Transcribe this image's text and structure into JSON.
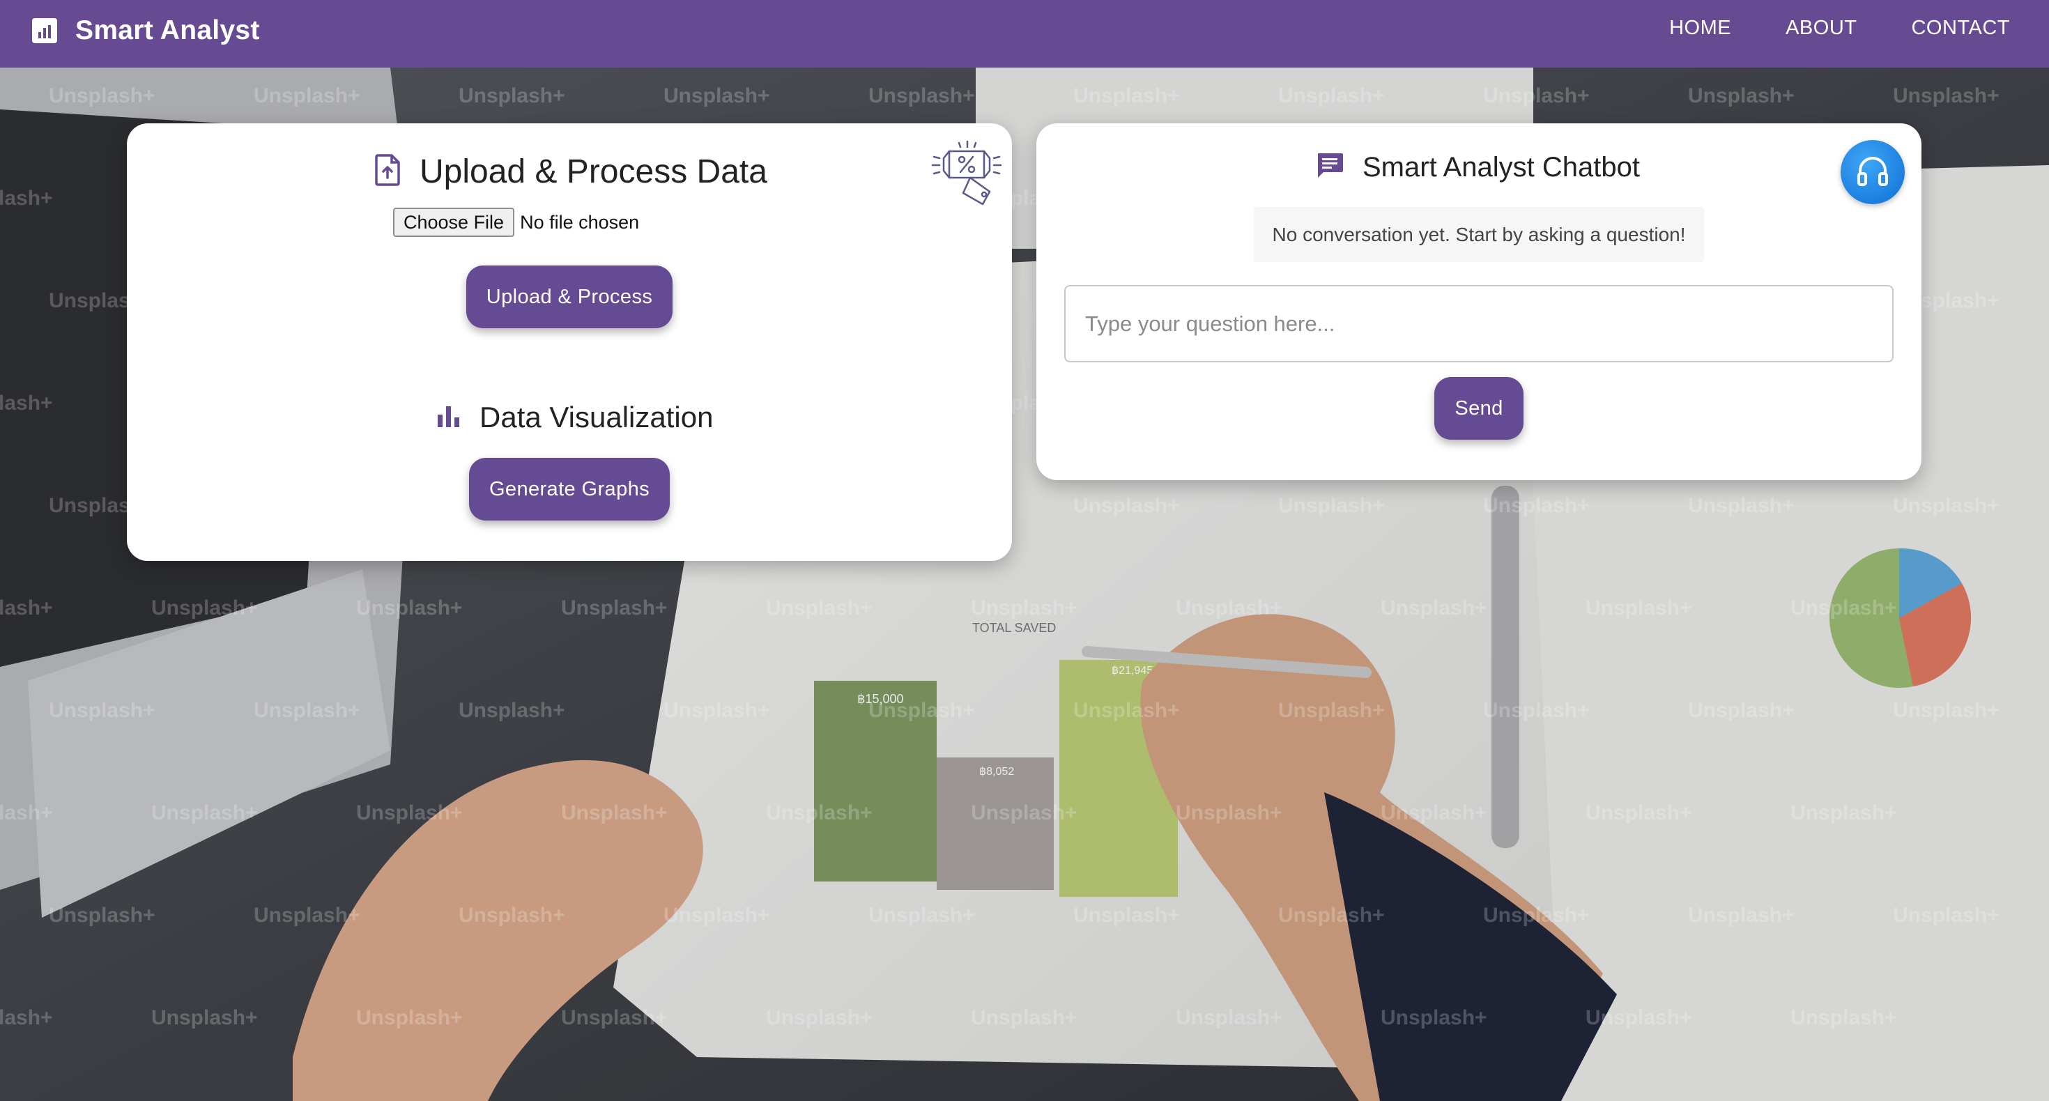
{
  "navbar": {
    "brand": "Smart Analyst",
    "links": [
      "HOME",
      "ABOUT",
      "CONTACT"
    ]
  },
  "upload_card": {
    "title": "Upload & Process Data",
    "choose_file_label": "Choose File",
    "file_status": "No file chosen",
    "upload_button": "Upload & Process",
    "viz_title": "Data Visualization",
    "generate_button": "Generate Graphs"
  },
  "chat_card": {
    "title": "Smart Analyst Chatbot",
    "empty_message": "No conversation yet. Start by asking a question!",
    "input_placeholder": "Type your question here...",
    "send_button": "Send"
  },
  "background": {
    "watermark": "Unsplash+",
    "chart_labels": [
      "฿15,000",
      "฿8,052",
      "฿21,945",
      "TOTAL SAVED"
    ]
  },
  "icons": {
    "brand": "bar-chart-icon",
    "upload": "file-upload-icon",
    "visualization": "bar-chart-icon",
    "discount": "discount-tag-icon",
    "chat": "chat-bubble-icon",
    "support": "headset-icon"
  },
  "colors": {
    "primary": "#664b93",
    "button": "#654a94",
    "support_badge": "#1c7fe0"
  }
}
